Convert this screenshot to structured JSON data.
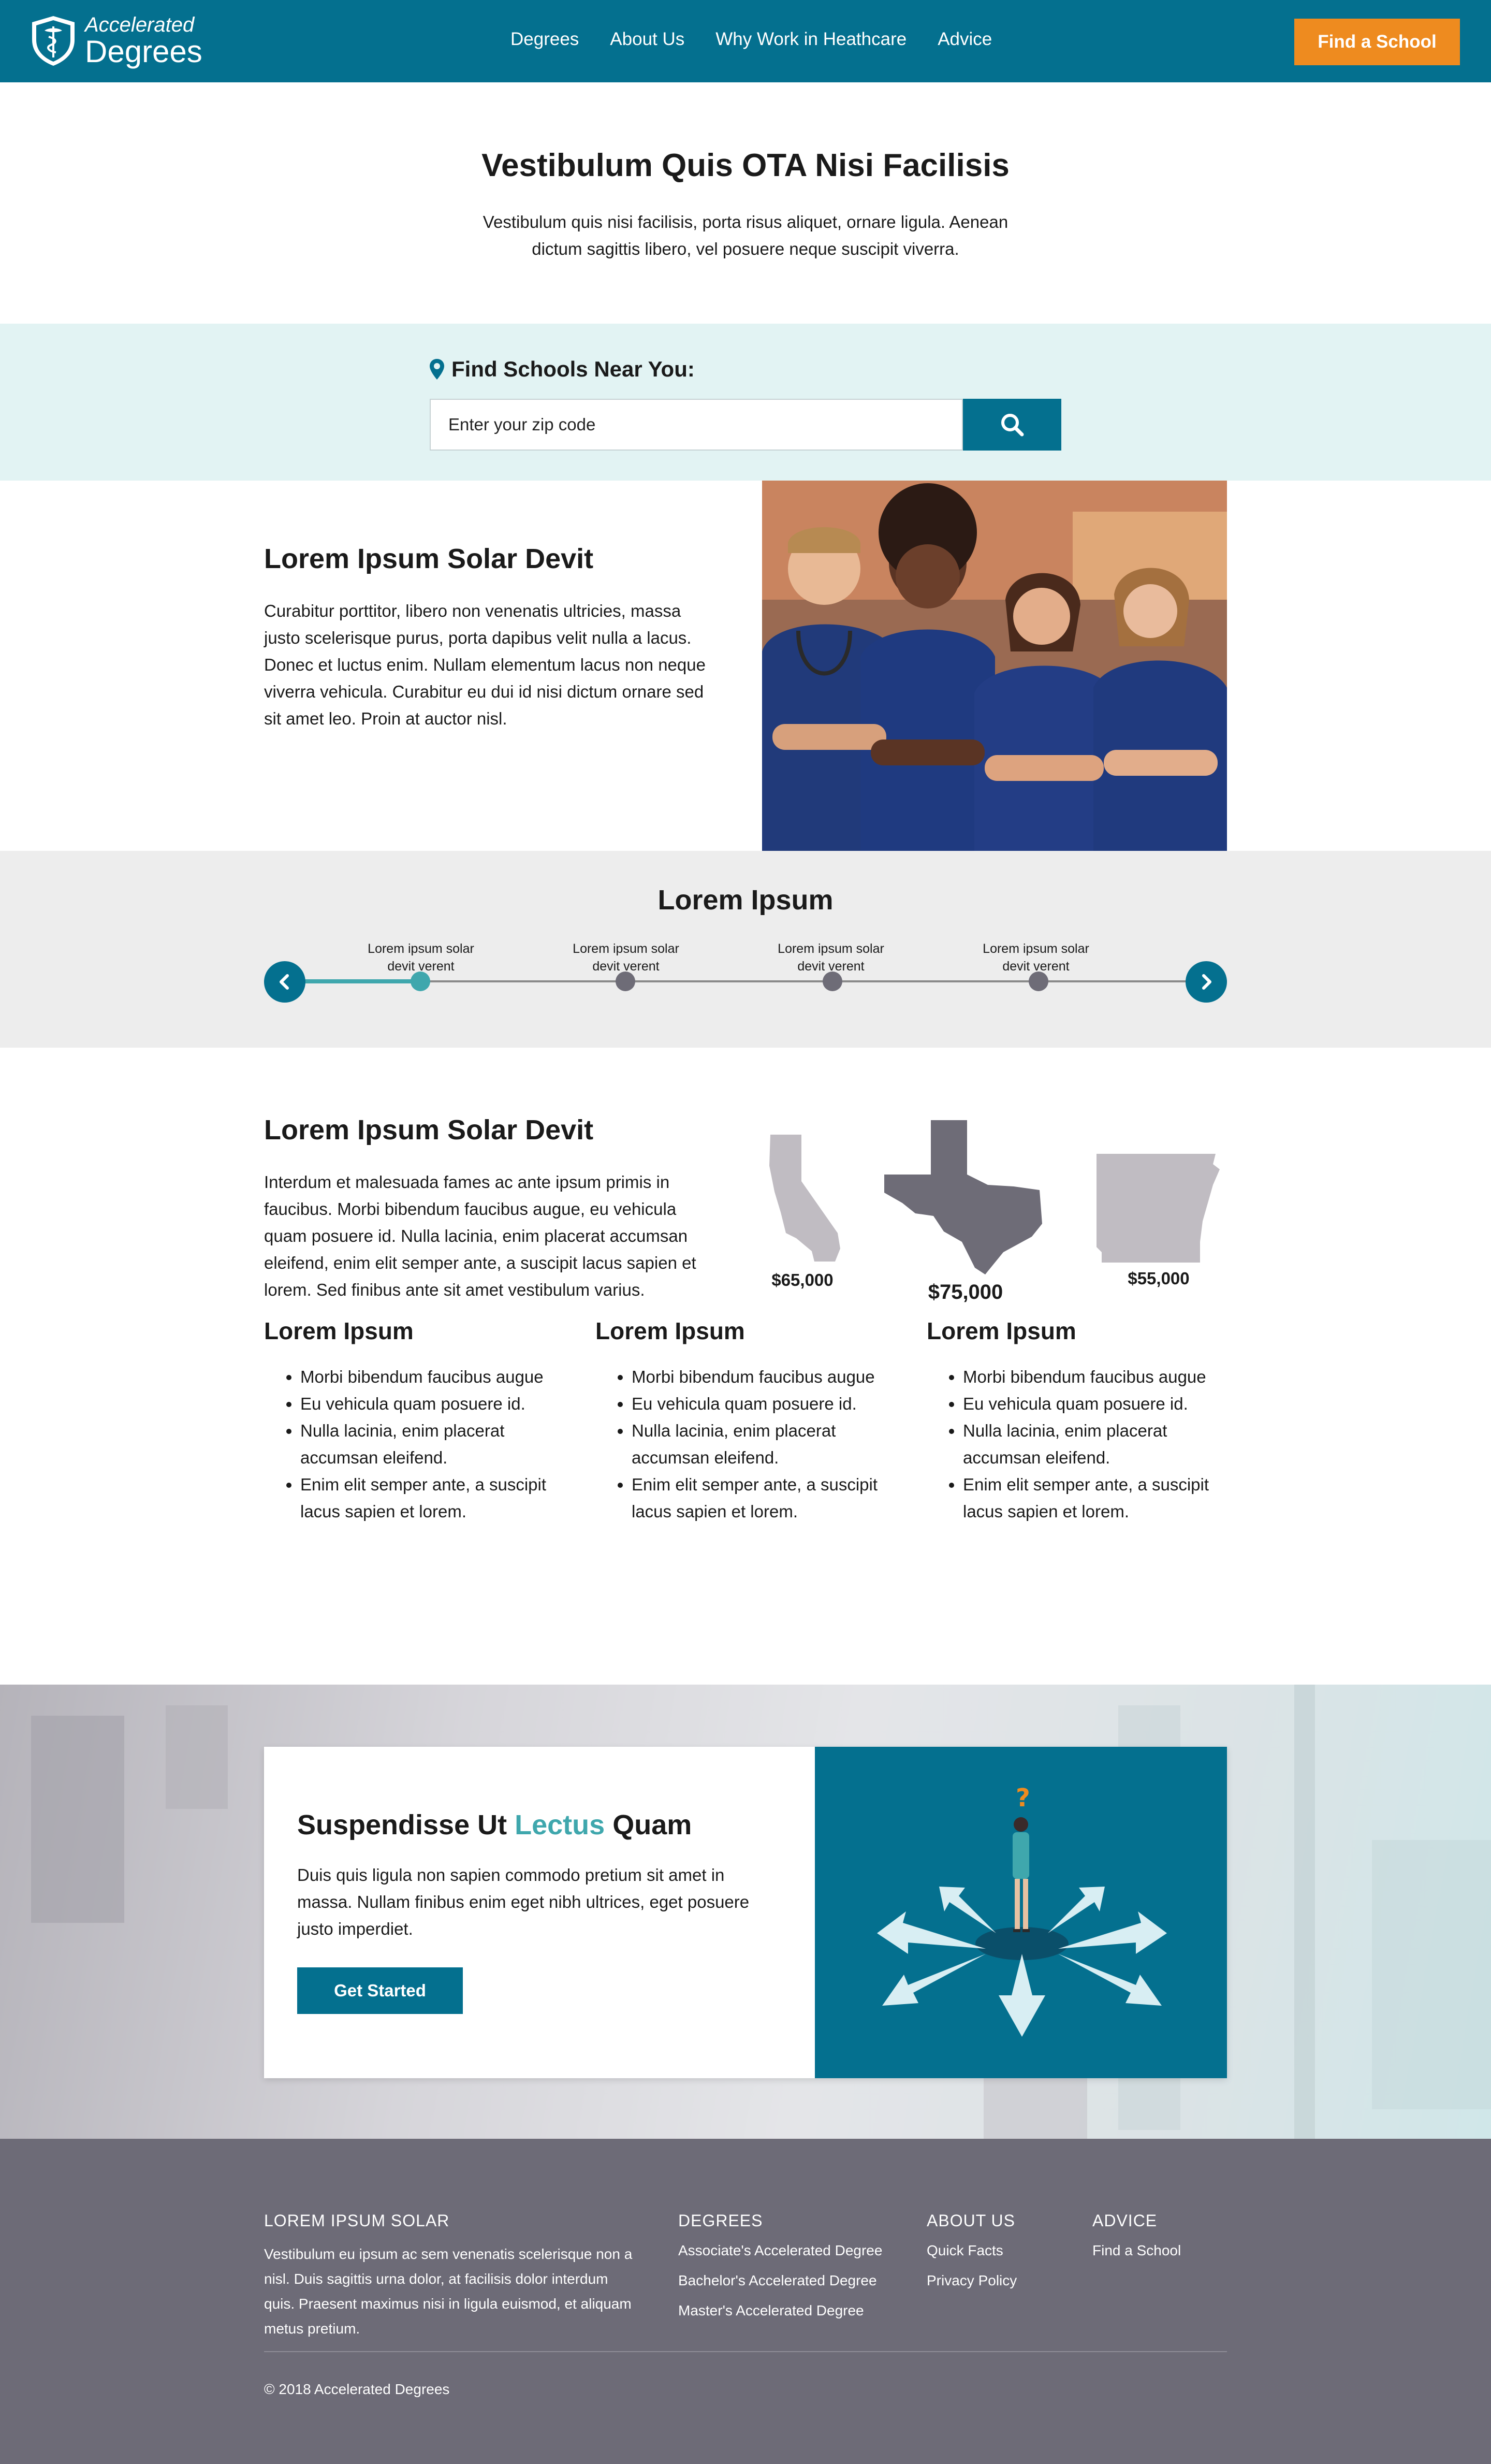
{
  "header": {
    "logo_line1": "Accelerated",
    "logo_line2": "Degrees",
    "nav": [
      "Degrees",
      "About Us",
      "Why Work in Heathcare",
      "Advice"
    ],
    "cta": "Find a School"
  },
  "hero": {
    "title": "Vestibulum Quis OTA Nisi Facilisis",
    "text": "Vestibulum quis nisi facilisis, porta risus aliquet, ornare ligula. Aenean dictum sagittis libero, vel posuere neque suscipit viverra."
  },
  "search": {
    "label": "Find Schools Near You:",
    "placeholder": "Enter your zip code"
  },
  "info1": {
    "title": "Lorem Ipsum Solar Devit",
    "text": "Curabitur porttitor, libero non venenatis ultricies, massa justo scelerisque purus, porta dapibus velit nulla a lacus. Donec et luctus enim. Nullam elementum lacus non neque viverra vehicula. Curabitur eu dui id nisi dictum ornare sed sit amet leo. Proin at auctor nisl."
  },
  "timeline": {
    "title": "Lorem Ipsum",
    "steps": [
      "Lorem ipsum solar devit verent",
      "Lorem ipsum solar devit verent",
      "Lorem ipsum solar devit verent",
      "Lorem ipsum solar devit verent"
    ],
    "active_index": 0
  },
  "info2": {
    "title": "Lorem Ipsum Solar Devit",
    "text": "Interdum et malesuada fames ac ante ipsum primis in faucibus. Morbi bibendum faucibus augue, eu vehicula quam posuere id. Nulla lacinia, enim placerat accumsan eleifend, enim elit semper ante, a suscipit lacus sapien et lorem. Sed finibus ante sit amet vestibulum varius.",
    "states": [
      {
        "value": "$65,000",
        "color": "#c0bcc2"
      },
      {
        "value": "$75,000",
        "color": "#6e6c77"
      },
      {
        "value": "$55,000",
        "color": "#c0bcc2"
      }
    ]
  },
  "columns": [
    {
      "title": "Lorem Ipsum",
      "items": [
        "Morbi bibendum faucibus augue",
        "Eu vehicula quam posuere id.",
        "Nulla lacinia, enim placerat accumsan eleifend.",
        "Enim elit semper ante, a suscipit lacus sapien et lorem."
      ]
    },
    {
      "title": "Lorem Ipsum",
      "items": [
        "Morbi bibendum faucibus augue",
        "Eu vehicula quam posuere id.",
        "Nulla lacinia, enim placerat accumsan eleifend.",
        "Enim elit semper ante, a suscipit lacus sapien et lorem."
      ]
    },
    {
      "title": "Lorem Ipsum",
      "items": [
        "Morbi bibendum faucibus augue",
        "Eu vehicula quam posuere id.",
        "Nulla lacinia, enim placerat accumsan eleifend.",
        "Enim elit semper ante, a suscipit lacus sapien et lorem."
      ]
    }
  ],
  "cta": {
    "title_pre": "Suspendisse Ut",
    "title_accent": "Lectus",
    "title_post": "Quam",
    "text": "Duis quis ligula non sapien commodo pretium sit amet in massa. Nullam finibus enim eget nibh ultrices, eget posuere justo imperdiet.",
    "button": "Get Started",
    "question_mark": "?"
  },
  "footer": {
    "about_title": "LOREM IPSUM SOLAR",
    "about_text": "Vestibulum eu ipsum ac sem venenatis scelerisque non a nisl. Duis sagittis urna dolor, at facilisis dolor interdum quis. Praesent maximus nisi in ligula euismod, et aliquam metus pretium.",
    "degrees_title": "DEGREES",
    "degrees_links": [
      "Associate's Accelerated Degree",
      "Bachelor's Accelerated Degree",
      "Master's Accelerated Degree"
    ],
    "aboutus_title": "ABOUT US",
    "aboutus_links": [
      "Quick Facts",
      "Privacy Policy"
    ],
    "advice_title": "ADVICE",
    "advice_links": [
      "Find a School"
    ],
    "copyright": "© 2018 Accelerated Degrees"
  },
  "colors": {
    "brand": "#04708f",
    "accent_orange": "#ee8b1f",
    "teal": "#3fa7ad",
    "footer": "#6d6b77"
  }
}
